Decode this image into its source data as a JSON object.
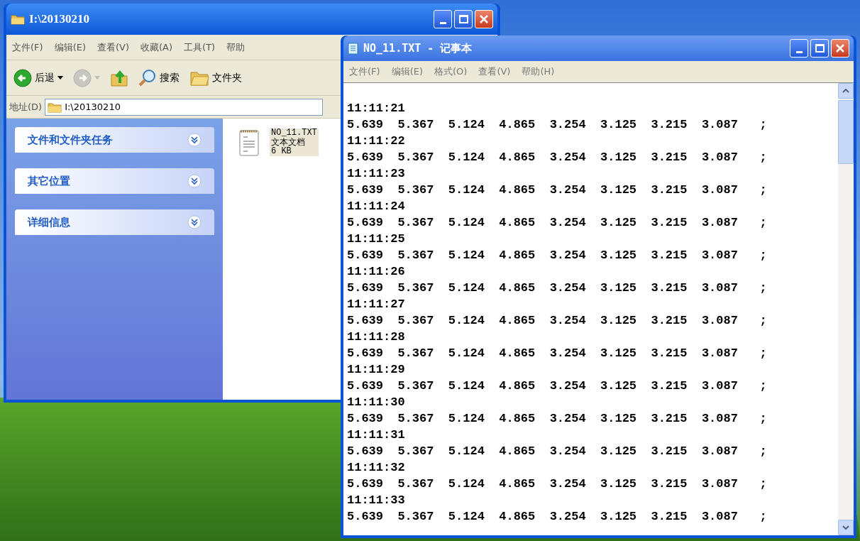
{
  "explorer": {
    "title": "I:\\20130210",
    "menu": [
      "文件(F)",
      "编辑(E)",
      "查看(V)",
      "收藏(A)",
      "工具(T)",
      "帮助"
    ],
    "toolbar": [
      {
        "kind": "back",
        "label": "后退",
        "disabled": false
      },
      {
        "kind": "forward",
        "disabled": true
      },
      {
        "kind": "up",
        "disabled": false
      },
      {
        "kind": "search",
        "label": "搜索",
        "disabled": false
      },
      {
        "kind": "folders",
        "label": "文件夹",
        "disabled": false
      }
    ],
    "address": {
      "label": "地址(D)",
      "value": "I:\\20130210"
    },
    "tasks": [
      {
        "title": "文件和文件夹任务",
        "expanded": false
      },
      {
        "title": "其它位置",
        "expanded": false
      },
      {
        "title": "详细信息",
        "expanded": false
      }
    ],
    "files": [
      {
        "name": "NO_11.TXT",
        "type": "文本文档",
        "size": "6 KB",
        "selected": true
      }
    ]
  },
  "notepad": {
    "title": "NO_11.TXT - 记事本",
    "menu": [
      "文件(F)",
      "编辑(E)",
      "格式(O)",
      "查看(V)",
      "帮助(H)"
    ],
    "lines": [
      "11:11:21",
      "5.639  5.367  5.124  4.865  3.254  3.125  3.215  3.087   ;",
      "11:11:22",
      "5.639  5.367  5.124  4.865  3.254  3.125  3.215  3.087   ;",
      "11:11:23",
      "5.639  5.367  5.124  4.865  3.254  3.125  3.215  3.087   ;",
      "11:11:24",
      "5.639  5.367  5.124  4.865  3.254  3.125  3.215  3.087   ;",
      "11:11:25",
      "5.639  5.367  5.124  4.865  3.254  3.125  3.215  3.087   ;",
      "11:11:26",
      "5.639  5.367  5.124  4.865  3.254  3.125  3.215  3.087   ;",
      "11:11:27",
      "5.639  5.367  5.124  4.865  3.254  3.125  3.215  3.087   ;",
      "11:11:28",
      "5.639  5.367  5.124  4.865  3.254  3.125  3.215  3.087   ;",
      "11:11:29",
      "5.639  5.367  5.124  4.865  3.254  3.125  3.215  3.087   ;",
      "11:11:30",
      "5.639  5.367  5.124  4.865  3.254  3.125  3.215  3.087   ;",
      "11:11:31",
      "5.639  5.367  5.124  4.865  3.254  3.125  3.215  3.087   ;",
      "11:11:32",
      "5.639  5.367  5.124  4.865  3.254  3.125  3.215  3.087   ;",
      "11:11:33",
      "5.639  5.367  5.124  4.865  3.254  3.125  3.215  3.087   ;"
    ]
  }
}
